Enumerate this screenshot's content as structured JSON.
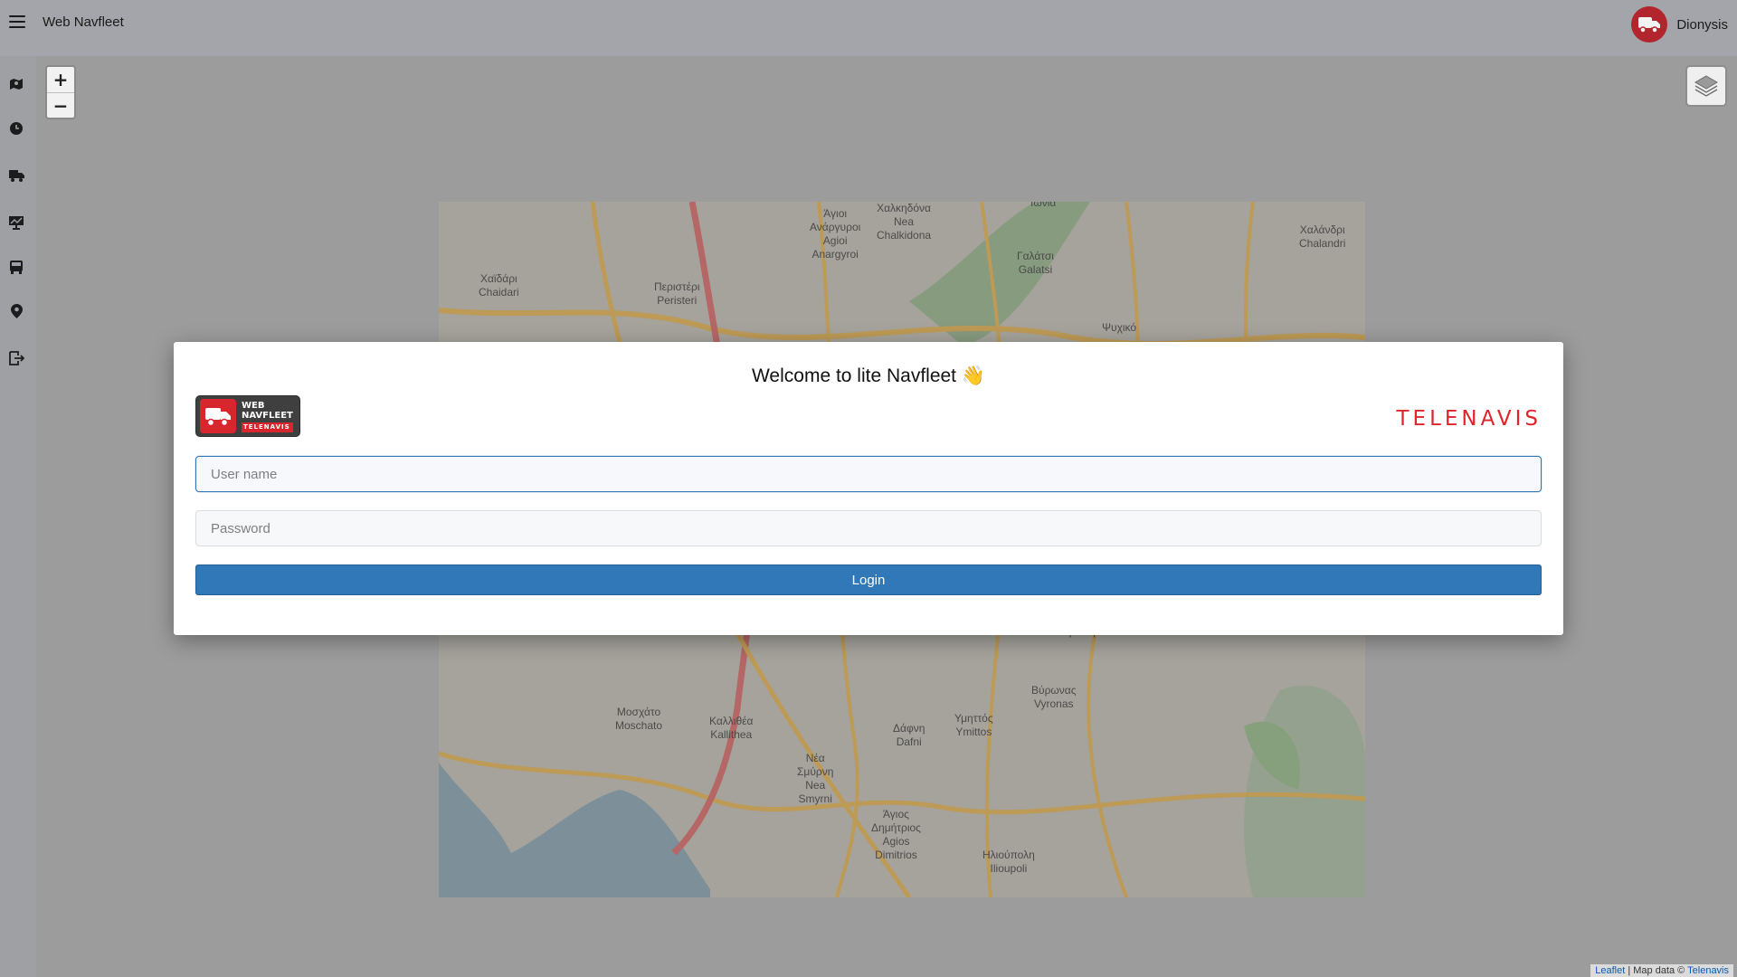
{
  "header": {
    "app_title": "Web Navfleet",
    "user_name": "Dionysis"
  },
  "map": {
    "zoom_in": "+",
    "zoom_out": "−",
    "labels": [
      {
        "text": "Χαλκηδόνα\nΝea\nChalkidona"
      },
      {
        "text": "Άγιοι\nΑνάργυροι\nAgioi\nAnargyroi"
      },
      {
        "text": "Ιωνία"
      },
      {
        "text": "Χαϊδάρι\nChaidari"
      },
      {
        "text": "Περιστέρι\nPeristeri"
      },
      {
        "text": "Γαλάτσι\nGalatsi"
      },
      {
        "text": "Χαλάνδρι\nChalandri"
      },
      {
        "text": "Ψυχικό"
      },
      {
        "text": "Μοσχάτο\nMoschato"
      },
      {
        "text": "Καλλιθέα\nKallithea"
      },
      {
        "text": "Δάφνη\nDafni"
      },
      {
        "text": "Υμηττός\nYmittos"
      },
      {
        "text": "Βύρωνας\nVyronas"
      },
      {
        "text": "Νέα\nΣμύρνη\nNea\nSmyrni"
      },
      {
        "text": "Άγιος\nΔημήτριος\nAgios\nDimitrios"
      },
      {
        "text": "Ηλιούπολη\nIlioupoli"
      },
      {
        "text": "Καισαριανή"
      }
    ],
    "attribution": {
      "leaflet": "Leaflet",
      "middle": " | Map data © ",
      "provider": "Telenavis"
    }
  },
  "modal": {
    "title": "Welcome to lite Navfleet 👋",
    "logo_left": {
      "line1": "WEB",
      "line2": "NAVFLEET",
      "line3": "TELENAVIS"
    },
    "logo_right": "TELENAVIS",
    "username_placeholder": "User name",
    "password_placeholder": "Password",
    "login_label": "Login"
  },
  "colors": {
    "accent": "#3178b9",
    "brand_red": "#d8262e",
    "overlay": "#9a9a9a"
  },
  "sidebar": {
    "icons": [
      "map-icon",
      "clock-icon",
      "truck-icon",
      "chart-icon",
      "bus-icon",
      "location-pin-icon",
      "logout-icon"
    ]
  }
}
